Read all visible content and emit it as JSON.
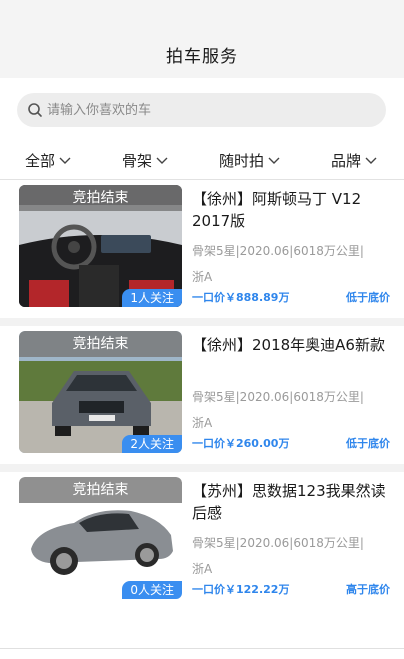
{
  "header": {
    "title": "拍车服务"
  },
  "search": {
    "placeholder": "请输入你喜欢的车"
  },
  "filters": [
    {
      "label": "全部"
    },
    {
      "label": "骨架"
    },
    {
      "label": "随时拍"
    },
    {
      "label": "品牌"
    }
  ],
  "listings": [
    {
      "status": "竞拍结束",
      "followers": "1人关注",
      "title": "【徐州】阿斯顿马丁 V12 2017版",
      "specs": "骨架5星|2020.06|6018万公里|",
      "region": "浙A",
      "price": "一口价￥888.89万",
      "price_tag": "低于底价"
    },
    {
      "status": "竞拍结束",
      "followers": "2人关注",
      "title": "【徐州】2018年奥迪A6新款",
      "specs": "骨架5星|2020.06|6018万公里|",
      "region": "浙A",
      "price": "一口价￥260.00万",
      "price_tag": "低于底价"
    },
    {
      "status": "竞拍结束",
      "followers": "0人关注",
      "title": "【苏州】思数据123我果然读后感",
      "specs": "骨架5星|2020.06|6018万公里|",
      "region": "浙A",
      "price": "一口价￥122.22万",
      "price_tag": "高于底价"
    }
  ],
  "colors": {
    "accent": "#2f86ec",
    "badge": "#3a8ef0",
    "header_bg": "#f4f4f4"
  },
  "icons": {
    "search": "search-icon",
    "filter_chevron": "chevron-down-icon"
  }
}
